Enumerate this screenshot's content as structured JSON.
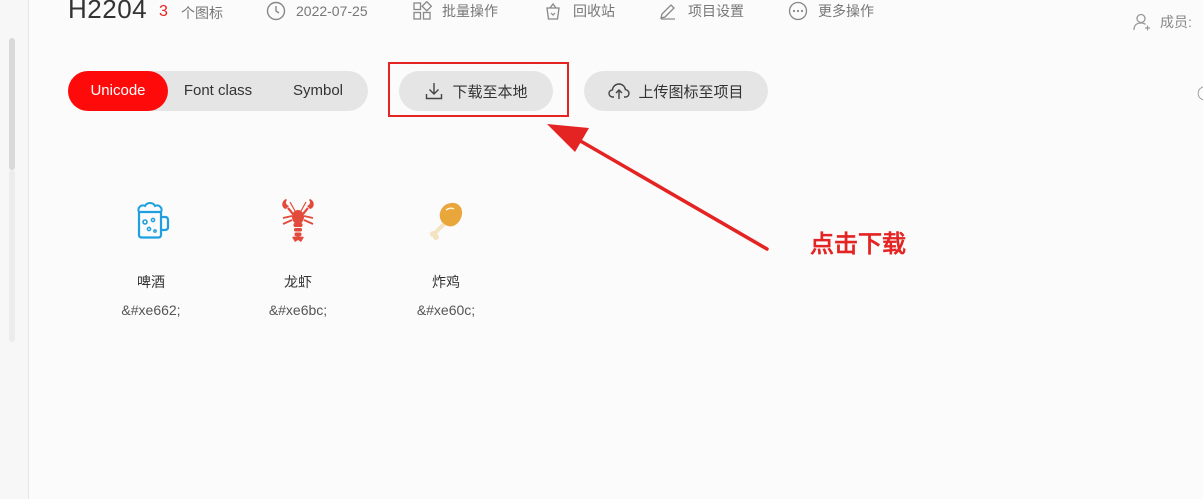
{
  "header": {
    "project_title": "H2204",
    "icon_count": "3",
    "icon_count_label": "个图标",
    "date": "2022-07-25",
    "batch_ops": "批量操作",
    "recycle_bin": "回收站",
    "project_settings": "项目设置",
    "more_ops": "更多操作",
    "members_label": "成员:"
  },
  "modes": {
    "unicode": "Unicode",
    "font_class": "Font class",
    "symbol": "Symbol",
    "active": "Unicode"
  },
  "actions": {
    "download_local": "下载至本地",
    "upload_icons": "上传图标至项目"
  },
  "icons": [
    {
      "name": "啤酒",
      "code": "&#xe662;",
      "icon": "beer-mug-icon",
      "color": "#1e9fe0"
    },
    {
      "name": "龙虾",
      "code": "&#xe6bc;",
      "icon": "lobster-icon",
      "color": "#e24a3b"
    },
    {
      "name": "炸鸡",
      "code": "&#xe60c;",
      "icon": "fried-chicken-leg-icon",
      "color": "#e9a63a"
    }
  ],
  "annotation": {
    "text": "点击下载",
    "color": "#e42323"
  },
  "colors": {
    "accent": "#ff0a0a",
    "count": "#ee2222"
  }
}
